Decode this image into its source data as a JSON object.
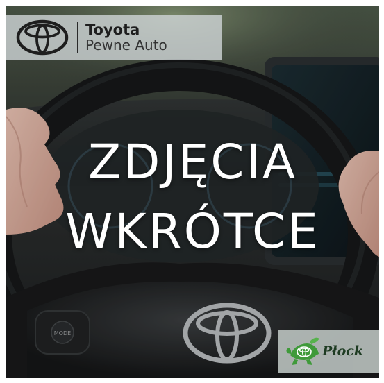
{
  "brand": {
    "name": "Toyota",
    "subtitle": "Pewne Auto",
    "logo_icon": "toyota-logo-icon"
  },
  "headline": {
    "line1": "ZDJĘCIA",
    "line2": "WKRÓTCE"
  },
  "dealer": {
    "name": "Płock",
    "logo_icon": "turtle-emblem-icon"
  },
  "colors": {
    "badge_bg": "#cdd3d4",
    "headline_text": "#ffffff",
    "dealer_green": "#3f9a3a"
  }
}
